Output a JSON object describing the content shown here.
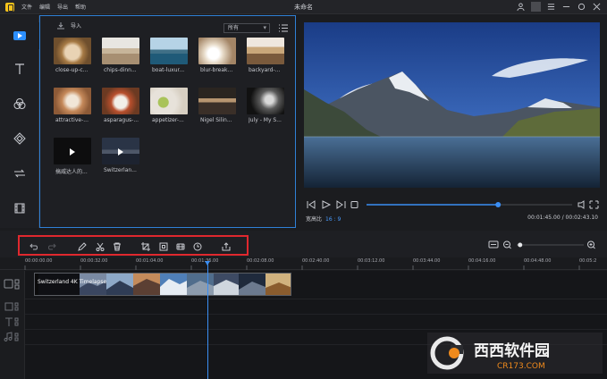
{
  "titlebar": {
    "title": "未命名",
    "menu": [
      "文件",
      "编辑",
      "导出",
      "帮助"
    ]
  },
  "sidebar": {
    "items": [
      "media-icon",
      "text-icon",
      "filter-icon",
      "overlay-icon",
      "transition-icon",
      "element-icon"
    ]
  },
  "library": {
    "import_label": "导入",
    "filter_value": "所有",
    "items": [
      {
        "caption": "close-up-c...",
        "type": "image"
      },
      {
        "caption": "chips-dinn...",
        "type": "image"
      },
      {
        "caption": "boat-luxur...",
        "type": "image"
      },
      {
        "caption": "blur-break...",
        "type": "image"
      },
      {
        "caption": "backyard-...",
        "type": "image"
      },
      {
        "caption": "attractive-...",
        "type": "image"
      },
      {
        "caption": "asparagus-...",
        "type": "image"
      },
      {
        "caption": "appetizer-...",
        "type": "image"
      },
      {
        "caption": "Nigel Silin...",
        "type": "image"
      },
      {
        "caption": "July - My S...",
        "type": "image"
      },
      {
        "caption": "搞威达人的...",
        "type": "video"
      },
      {
        "caption": "Switzerlan...",
        "type": "video"
      }
    ]
  },
  "preview": {
    "ratio_label": "宽高比",
    "ratio_value": "16 : 9",
    "time": "00:01:45.00 / 00:02:43.10",
    "progress": 0.64
  },
  "timeline": {
    "ticks": [
      "00:00:00.00",
      "00:00:32.00",
      "00:01:04.00",
      "00:01:36.00",
      "00:02:08.00",
      "00:02:40.00",
      "00:03:12.00",
      "00:03:44.00",
      "00:04:16.00",
      "00:04:48.00",
      "00:05:2"
    ],
    "clip_label": "Switzerland 4K Timelapse ",
    "clip_prefix": "og"
  },
  "zoom": {
    "level": 0.05
  },
  "watermark": {
    "line1": "西西软件园",
    "line2": "CR173.COM"
  },
  "colors": {
    "accent": "#2f80d6",
    "highlight": "#e0282e"
  }
}
